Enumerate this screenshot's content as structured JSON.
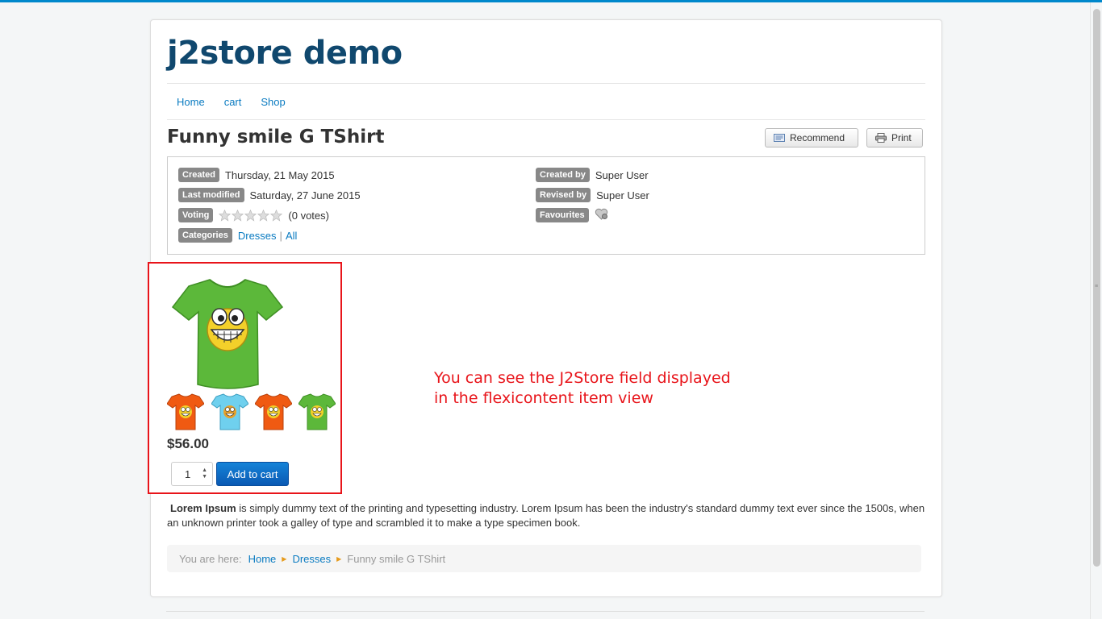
{
  "site": {
    "title": "j2store demo"
  },
  "nav": [
    "Home",
    "cart",
    "Shop"
  ],
  "item": {
    "title": "Funny smile G TShirt",
    "recommend_label": "Recommend",
    "print_label": "Print"
  },
  "meta": {
    "created_label": "Created",
    "created_value": "Thursday, 21 May 2015",
    "modified_label": "Last modified",
    "modified_value": "Saturday, 27 June 2015",
    "voting_label": "Voting",
    "votes_text": "(0 votes)",
    "rating_stars": 0,
    "categories_label": "Categories",
    "categories": [
      "Dresses",
      "All"
    ],
    "category_separator": "|",
    "createdby_label": "Created by",
    "createdby_value": "Super User",
    "revisedby_label": "Revised by",
    "revisedby_value": "Super User",
    "favourites_label": "Favourites"
  },
  "product": {
    "price": "$56.00",
    "quantity": "1",
    "add_to_cart_label": "Add to cart",
    "thumbnails": [
      "orange-tshirt",
      "light-blue-tshirt",
      "orange-tshirt",
      "green-tshirt"
    ]
  },
  "annotation": {
    "line1": "You can see the J2Store field displayed",
    "line2": "in the flexicontent item view"
  },
  "description": {
    "bold": "Lorem Ipsum",
    "text": " is simply dummy text of the printing and typesetting industry. Lorem Ipsum has been the industry's standard dummy text ever since the 1500s, when an unknown printer took a galley of type and scrambled it to make a type specimen book."
  },
  "breadcrumb": {
    "prefix": "You are here:",
    "items": [
      "Home",
      "Dresses",
      "Funny smile G TShirt"
    ]
  },
  "colors": {
    "accent": "#0a7bc1",
    "title": "#10486e",
    "highlight": "#e8141a",
    "shirt_green": "#5cb83a",
    "shirt_orange": "#f05a12",
    "shirt_blue": "#6fd0ee"
  }
}
